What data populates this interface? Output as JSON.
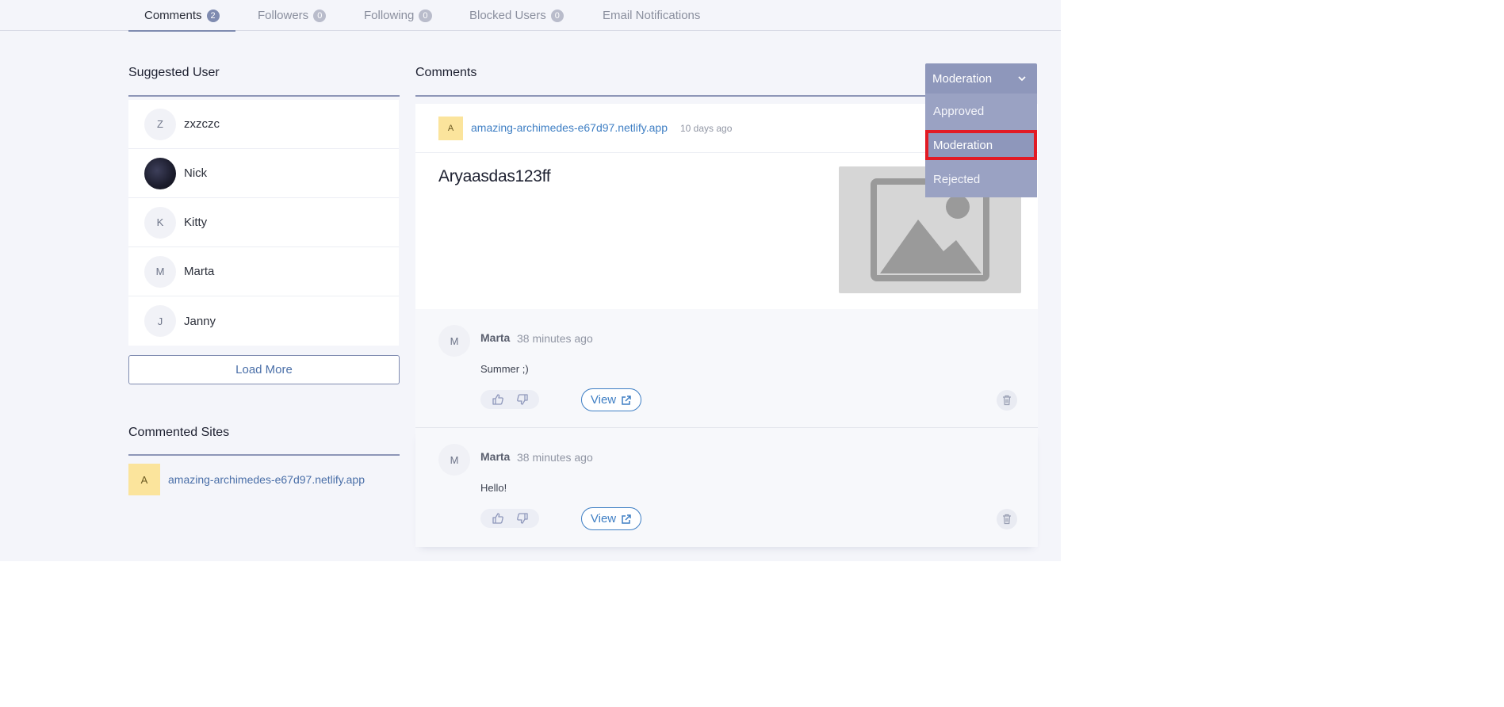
{
  "tabs": [
    {
      "label": "Comments",
      "count": "2"
    },
    {
      "label": "Followers",
      "count": "0"
    },
    {
      "label": "Following",
      "count": "0"
    },
    {
      "label": "Blocked Users",
      "count": "0"
    },
    {
      "label": "Email Notifications"
    }
  ],
  "sidebar": {
    "suggested_title": "Suggested User",
    "users": [
      {
        "initial": "Z",
        "name": "zxzczc"
      },
      {
        "initial": "",
        "name": "Nick"
      },
      {
        "initial": "K",
        "name": "Kitty"
      },
      {
        "initial": "M",
        "name": "Marta"
      },
      {
        "initial": "J",
        "name": "Janny"
      }
    ],
    "load_more": "Load More",
    "sites_title": "Commented Sites",
    "sites": [
      {
        "initial": "A",
        "url": "amazing-archimedes-e67d97.netlify.app"
      }
    ]
  },
  "main": {
    "title": "Comments",
    "post": {
      "site_initial": "A",
      "site_url": "amazing-archimedes-e67d97.netlify.app",
      "time": "10 days ago",
      "title": "Aryaasdas123ff"
    },
    "comments": [
      {
        "initial": "M",
        "author": "Marta",
        "time": "38 minutes ago",
        "text": "Summer ;)",
        "view_label": "View"
      },
      {
        "initial": "M",
        "author": "Marta",
        "time": "38 minutes ago",
        "text": "Hello!",
        "view_label": "View"
      }
    ]
  },
  "filter": {
    "selected": "Moderation",
    "options": [
      "Approved",
      "Moderation",
      "Rejected"
    ]
  },
  "colors": {
    "accent": "#8e97bb",
    "link": "#3f7fc4",
    "highlight": "#e21a24",
    "site_badge": "#fbe49c"
  }
}
